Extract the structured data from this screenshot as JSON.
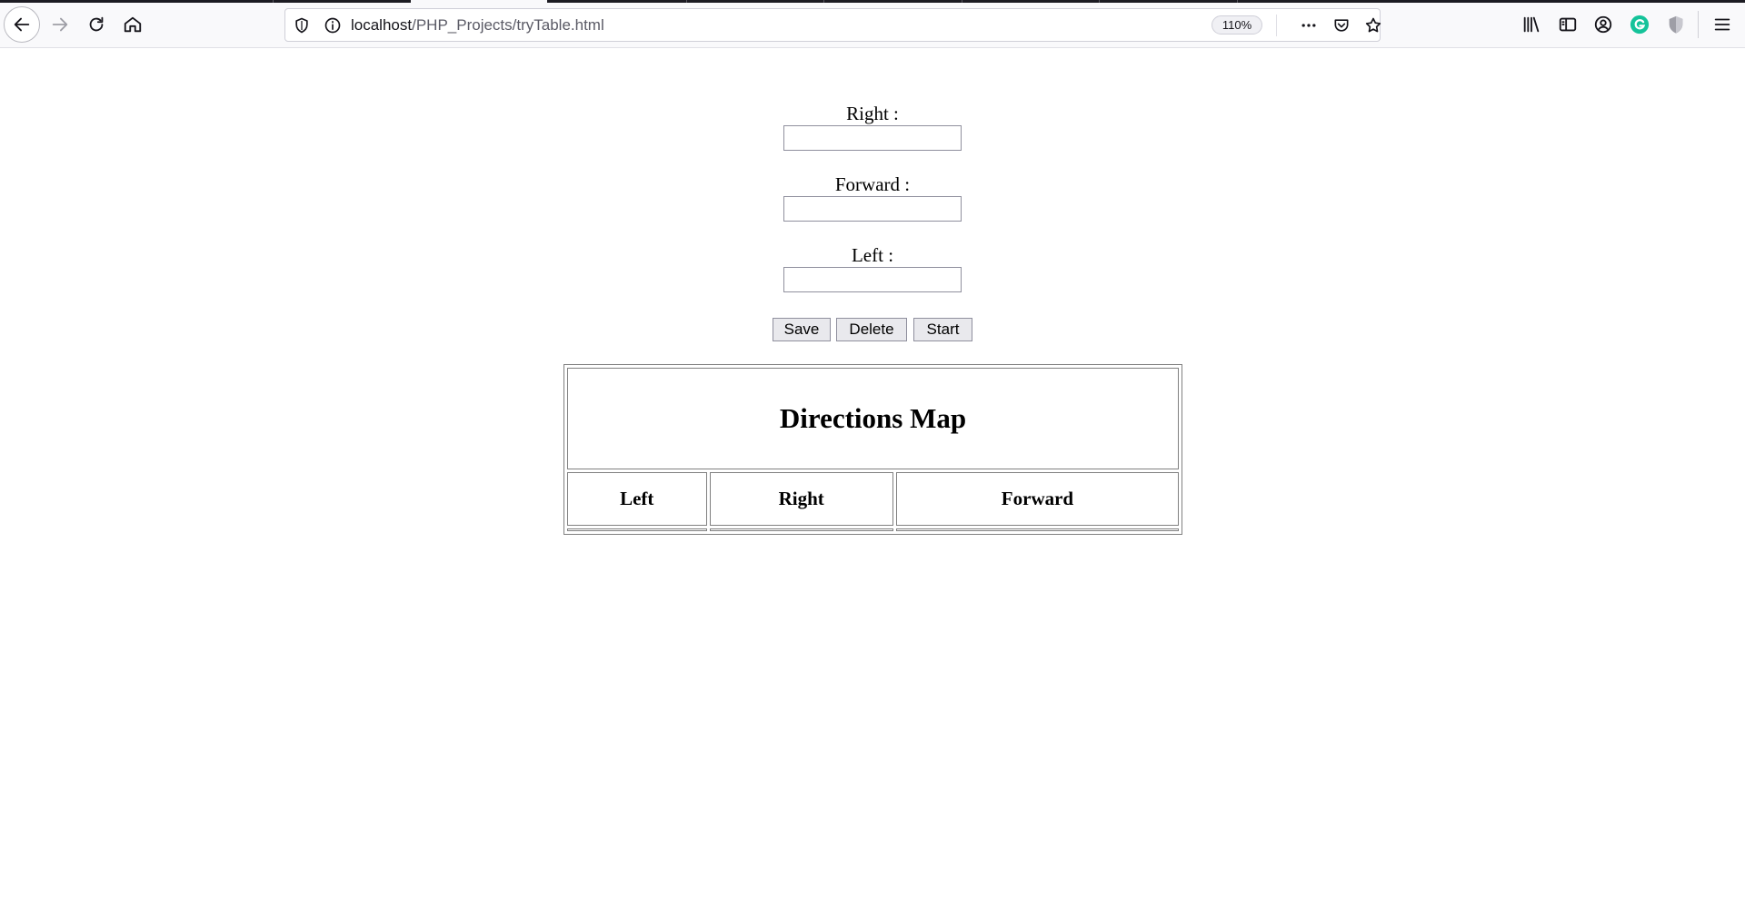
{
  "browser": {
    "url_host": "localhost",
    "url_path": "/PHP_Projects/tryTable.html",
    "zoom": "110%",
    "icons": {
      "back": "arrow-left-icon",
      "forward": "arrow-right-icon",
      "reload": "reload-icon",
      "home": "home-icon",
      "tracking": "shield-icon",
      "info": "info-icon",
      "more": "ellipsis-icon",
      "pocket": "pocket-icon",
      "bookmark": "star-icon",
      "library": "library-icon",
      "sidebar": "sidebar-icon",
      "account": "account-icon",
      "grammarly": "grammarly-icon",
      "extension": "shield-extension-icon",
      "menu": "hamburger-menu-icon"
    },
    "colors": {
      "grammarly": "#15c39a",
      "extension": "#9e9ea6"
    }
  },
  "form": {
    "right_label": "Right :",
    "forward_label": "Forward :",
    "left_label": "Left :",
    "right_value": "",
    "forward_value": "",
    "left_value": "",
    "save_label": "Save",
    "delete_label": "Delete",
    "start_label": "Start"
  },
  "table": {
    "title": "Directions Map",
    "columns": [
      "Left",
      "Right",
      "Forward"
    ],
    "rows": []
  }
}
